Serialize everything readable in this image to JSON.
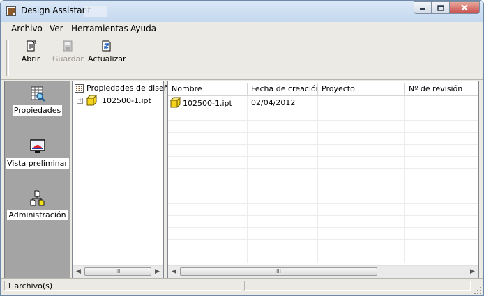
{
  "window": {
    "title": "Design Assistant"
  },
  "menu": [
    "Archivo",
    "Ver",
    "Herramientas",
    "Ayuda"
  ],
  "toolbar": {
    "buttons": [
      {
        "label": "Abrir",
        "icon": "open-document-icon",
        "enabled": true
      },
      {
        "label": "Guardar",
        "icon": "save-disk-icon",
        "enabled": false
      },
      {
        "label": "Actualizar",
        "icon": "refresh-icon",
        "enabled": true
      }
    ]
  },
  "nav": {
    "items": [
      {
        "label": "Propiedades",
        "icon": "properties-grid-icon"
      },
      {
        "label": "Vista preliminar",
        "icon": "monitor-preview-icon"
      },
      {
        "label": "Administración",
        "icon": "hierarchy-files-icon"
      }
    ]
  },
  "tree": {
    "header": "Propiedades de diseño",
    "nodes": [
      {
        "label": "102500-1.ipt",
        "expander": "+"
      }
    ],
    "scroll_thumb": "III"
  },
  "list": {
    "columns": [
      "Nombre",
      "Fecha de creación",
      "Proyecto",
      "Nº de revisión"
    ],
    "rows": [
      {
        "name": "102500-1.ipt",
        "date": "02/04/2012",
        "project": "",
        "revision": ""
      }
    ],
    "scroll_thumb": "III"
  },
  "status": {
    "text": "1 archivo(s)"
  },
  "colors": {
    "nav_bg": "#a4a4a4",
    "cube_yellow": "#f5d21b",
    "title_gradient": "#c4d8ef"
  }
}
